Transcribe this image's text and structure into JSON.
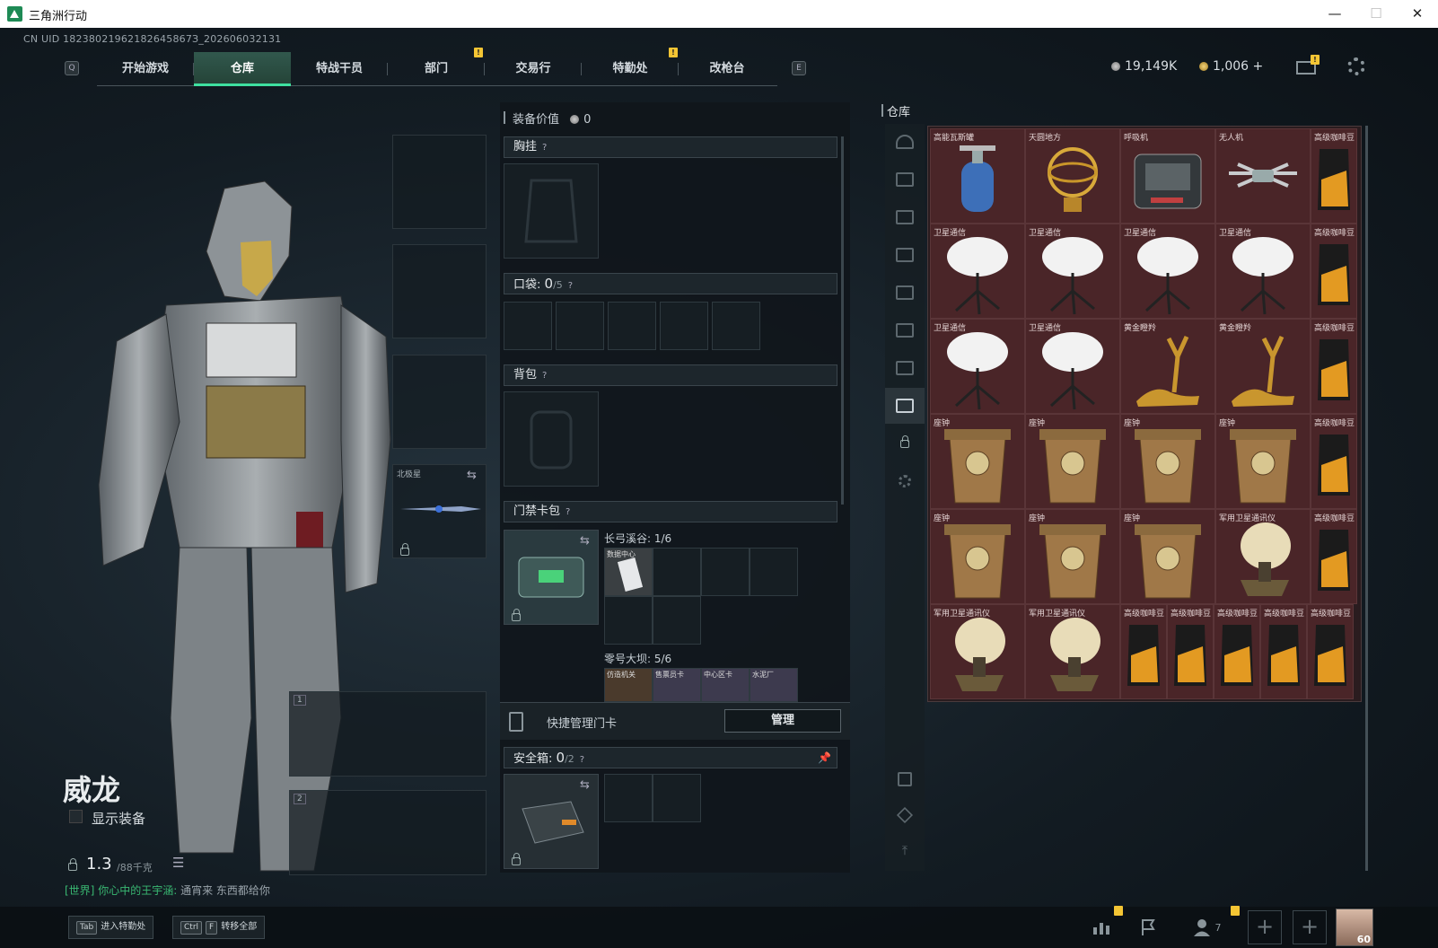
{
  "window": {
    "title": "三角洲行动",
    "minimize": "—",
    "maximize": "☐",
    "close": "✕"
  },
  "uid": "CN UID 18238021962182645867З_202606032131",
  "nav": {
    "left_key": "Q",
    "right_key": "E",
    "tabs": [
      {
        "label": "开始游戏"
      },
      {
        "label": "仓库"
      },
      {
        "label": "特战干员"
      },
      {
        "label": "部门",
        "badge": "!"
      },
      {
        "label": "交易行"
      },
      {
        "label": "特勤处",
        "badge": "!"
      },
      {
        "label": "改枪台"
      }
    ]
  },
  "currency": {
    "coins": "19,149K",
    "bonds": "1,006 +",
    "mail_badge": "!"
  },
  "character": {
    "name": "威龙",
    "show_gear_label": "显示装备",
    "weight": "1.3",
    "weight_unit": "/88千克",
    "melee_label": "北极星",
    "weapon_slot_1": "1",
    "weapon_slot_2": "2"
  },
  "chat": {
    "channel": "[世界]",
    "user": "你心中的王宇涵:",
    "message": "通宵来 东西都给你"
  },
  "equipment": {
    "value_label": "装备价值",
    "value": "0",
    "chest_rig_label": "胸挂",
    "pocket_label": "口袋:",
    "pocket_count": "0",
    "pocket_max": "/5",
    "backpack_label": "背包",
    "keycard_label": "门禁卡包",
    "keycard_sets": [
      {
        "name": "长弓溪谷: 1/6",
        "first_item": "数据中心"
      },
      {
        "name": "零号大坝: 5/6",
        "items": [
          "仿造机关",
          "售票员卡",
          "中心区卡",
          "水泥厂"
        ]
      }
    ],
    "quick_manage_label": "快捷管理门卡",
    "manage_button": "管理",
    "safebox_label": "安全箱:",
    "safebox_count": "0",
    "safebox_max": "/2"
  },
  "warehouse": {
    "title": "仓库",
    "items": [
      {
        "name": "高能瓦斯罐",
        "kind": "gas"
      },
      {
        "name": "天圆地方",
        "kind": "globe"
      },
      {
        "name": "呼吸机",
        "kind": "box"
      },
      {
        "name": "无人机",
        "kind": "drone"
      },
      {
        "name": "高级咖啡豆",
        "kind": "coffee"
      },
      {
        "name": "卫星通信",
        "kind": "dish"
      },
      {
        "name": "卫星通信",
        "kind": "dish"
      },
      {
        "name": "卫星通信",
        "kind": "dish"
      },
      {
        "name": "卫星通信",
        "kind": "dish"
      },
      {
        "name": "高级咖啡豆",
        "kind": "coffee"
      },
      {
        "name": "卫星通信",
        "kind": "dish"
      },
      {
        "name": "卫星通信",
        "kind": "dish"
      },
      {
        "name": "黄金瞪羚",
        "kind": "deer"
      },
      {
        "name": "黄金瞪羚",
        "kind": "deer"
      },
      {
        "name": "高级咖啡豆",
        "kind": "coffee"
      },
      {
        "name": "座钟",
        "kind": "clock"
      },
      {
        "name": "座钟",
        "kind": "clock"
      },
      {
        "name": "座钟",
        "kind": "clock"
      },
      {
        "name": "座钟",
        "kind": "clock"
      },
      {
        "name": "高级咖啡豆",
        "kind": "coffee"
      },
      {
        "name": "座钟",
        "kind": "clock"
      },
      {
        "name": "座钟",
        "kind": "clock"
      },
      {
        "name": "座钟",
        "kind": "clock"
      },
      {
        "name": "军用卫星通讯仪",
        "kind": "milsat"
      },
      {
        "name": "高级咖啡豆",
        "kind": "coffee"
      },
      {
        "name": "军用卫星通讯仪",
        "kind": "milsat"
      },
      {
        "name": "军用卫星通讯仪",
        "kind": "milsat"
      },
      {
        "name": "高级咖啡豆",
        "kind": "coffee"
      },
      {
        "name": "高级咖啡豆",
        "kind": "coffee"
      },
      {
        "name": "高级咖啡豆",
        "kind": "coffee"
      },
      {
        "name": "高级咖啡豆",
        "kind": "coffee"
      },
      {
        "name": "高级咖啡豆",
        "kind": "coffee"
      }
    ]
  },
  "bottom": {
    "hotkey1_key": "Tab",
    "hotkey1_label": "进入特勤处",
    "hotkey2_key": "Ctrl",
    "hotkey2_key2": "F",
    "hotkey2_label": "转移全部",
    "friends_count": "7",
    "avatar_level": "60"
  },
  "colors": {
    "accent": "#3ee0a0",
    "badge": "#f4c534",
    "item_bg": "#4a2528"
  }
}
